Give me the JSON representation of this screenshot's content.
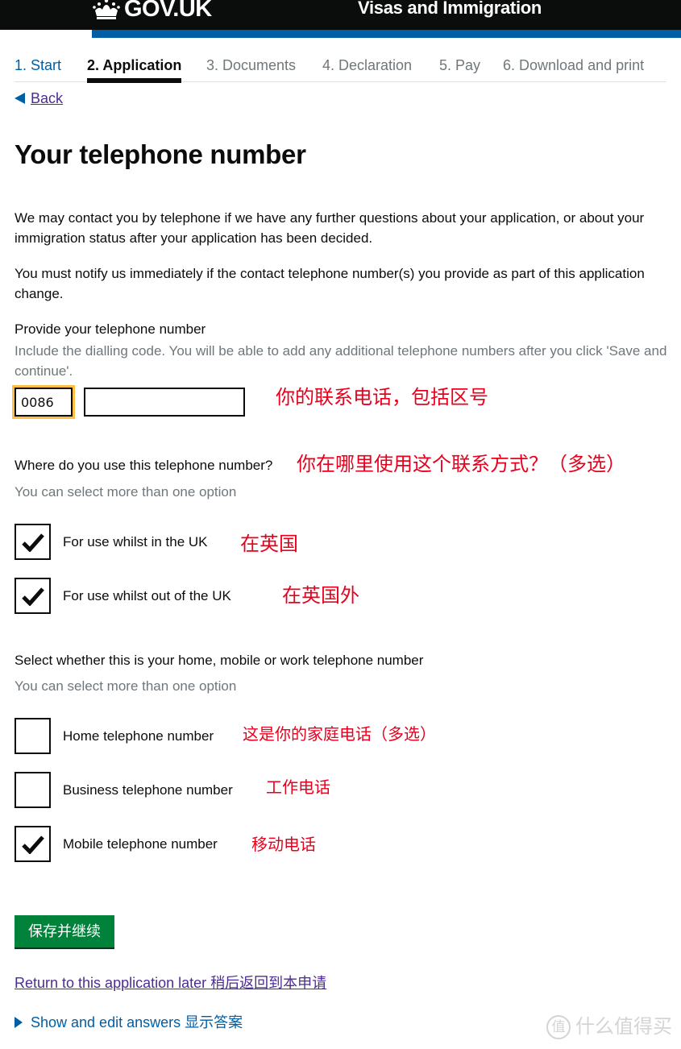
{
  "header": {
    "logo_text": "GOV.UK",
    "service_name": "Visas and Immigration",
    "colors": {
      "bar": "#0b0c0c",
      "accent": "#005ea5"
    }
  },
  "steps": [
    {
      "label": "1. Start",
      "state": "done"
    },
    {
      "label": "2. Application",
      "state": "current"
    },
    {
      "label": "3. Documents",
      "state": "upcoming"
    },
    {
      "label": "4. Declaration",
      "state": "upcoming"
    },
    {
      "label": "5. Pay",
      "state": "upcoming"
    },
    {
      "label": "6. Download and print",
      "state": "upcoming"
    }
  ],
  "back_link": "Back",
  "page_title": "Your telephone number",
  "intro": [
    "We may contact you by telephone if we have any further questions about your application, or about your immigration status after your application has been decided.",
    "You must notify us immediately if the contact telephone number(s) you provide as part of this application change."
  ],
  "phone": {
    "label": "Provide your telephone number",
    "hint": "Include the dialling code. You will be able to add any additional telephone numbers after you click 'Save and continue'.",
    "dialling_code_value": "0086",
    "number_value": "",
    "annotation": "你的联系电话，包括区号"
  },
  "usage": {
    "question": "Where do you use this telephone number?",
    "annotation": "你在哪里使用这个联系方式？（多选）",
    "hint": "You can select more than one option",
    "options": [
      {
        "label": "For use whilst in the UK",
        "checked": true,
        "annotation": "在英国"
      },
      {
        "label": "For use whilst out of the UK",
        "checked": true,
        "annotation": "在英国外"
      }
    ]
  },
  "type": {
    "question": "Select whether this is your home, mobile or work telephone number",
    "hint": "You can select more than one option",
    "options": [
      {
        "label": "Home telephone number",
        "checked": false,
        "annotation": "这是你的家庭电话（多选）"
      },
      {
        "label": "Business telephone number",
        "checked": false,
        "annotation": "工作电话"
      },
      {
        "label": "Mobile telephone number",
        "checked": true,
        "annotation": "移动电话"
      }
    ]
  },
  "save_button": "保存并继续",
  "return_link": "Return to this application later 稍后返回到本申请",
  "show_answers": "Show and edit answers 显示答案",
  "watermark": {
    "badge": "值",
    "text": "什么值得买"
  },
  "colors": {
    "button_green": "#00823b",
    "link_purple": "#4c2c92",
    "link_blue": "#005ea5",
    "annotation_red": "#e8001c",
    "focus_yellow": "#ffbf47",
    "hint_grey": "#6f777b"
  }
}
